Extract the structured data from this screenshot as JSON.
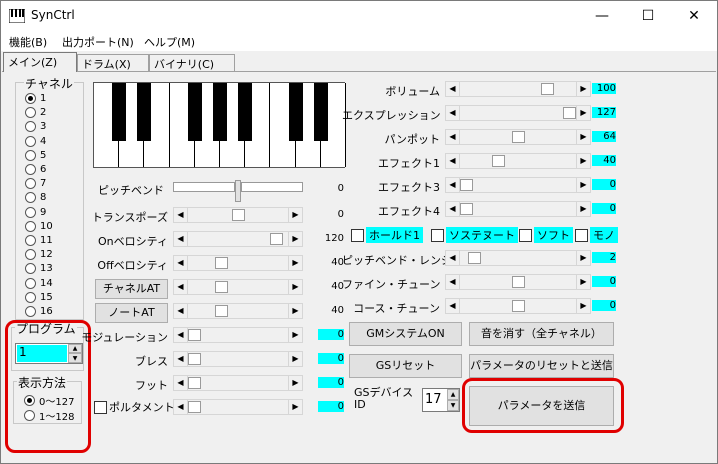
{
  "window": {
    "title": "SynCtrl",
    "minimize": "—",
    "maximize": "☐",
    "close": "✕"
  },
  "menu": [
    "機能(B)",
    "出力ポート(N)",
    "ヘルプ(M)"
  ],
  "tabs": [
    "メイン(Z)",
    "ドラム(X)",
    "バイナリ(C)"
  ],
  "channel": {
    "title": "チャネル",
    "items": [
      "1",
      "2",
      "3",
      "4",
      "5",
      "6",
      "7",
      "8",
      "9",
      "10",
      "11",
      "12",
      "13",
      "14",
      "15",
      "16"
    ],
    "selected": "1"
  },
  "program": {
    "title": "プログラム",
    "value": "1"
  },
  "display": {
    "title": "表示方法",
    "options": [
      "0〜127",
      "1〜128"
    ],
    "selected": "0〜127"
  },
  "left_controls": [
    {
      "label": "トランスポーズ",
      "value": "0",
      "fraction": 0.5,
      "cyan": false
    },
    {
      "label": "Onベロシティ",
      "value": "120",
      "fraction": 0.94,
      "cyan": false
    },
    {
      "label": "Offベロシティ",
      "value": "40",
      "fraction": 0.31,
      "cyan": false
    },
    {
      "label": "チャネルAT",
      "value": "40",
      "fraction": 0.31,
      "cyan": false,
      "button": true
    },
    {
      "label": "ノートAT",
      "value": "40",
      "fraction": 0.31,
      "cyan": false,
      "button": true
    },
    {
      "label": "モジュレーション",
      "value": "0",
      "fraction": 0,
      "cyan": true
    },
    {
      "label": "ブレス",
      "value": "0",
      "fraction": 0,
      "cyan": true
    },
    {
      "label": "フット",
      "value": "0",
      "fraction": 0,
      "cyan": true
    },
    {
      "label": "ポルタメント",
      "value": "0",
      "fraction": 0,
      "cyan": true,
      "check": true
    }
  ],
  "pitchbend": {
    "label": "ピッチベンド",
    "value": "0"
  },
  "right_controls": [
    {
      "label": "ボリューム",
      "value": "100",
      "fraction": 0.79
    },
    {
      "label": "エクスプレッション",
      "value": "127",
      "fraction": 1.0
    },
    {
      "label": "パンポット",
      "value": "64",
      "fraction": 0.5
    },
    {
      "label": "エフェクト1",
      "value": "40",
      "fraction": 0.31
    },
    {
      "label": "エフェクト3",
      "value": "0",
      "fraction": 0
    },
    {
      "label": "エフェクト4",
      "value": "0",
      "fraction": 0
    }
  ],
  "toggles": [
    "ホールド1",
    "ソステヌート",
    "ソフト",
    "モノ"
  ],
  "right_controls2": [
    {
      "label": "ピッチベンド・レンジ",
      "value": "2",
      "fraction": 0.08
    },
    {
      "label": "ファイン・チューン",
      "value": "0",
      "fraction": 0.5
    },
    {
      "label": "コース・チューン",
      "value": "0",
      "fraction": 0.5
    }
  ],
  "buttons": {
    "gm_on": "GMシステムON",
    "mute_all": "音を消す（全チャネル）",
    "gs_reset": "GSリセット",
    "reset_send": "パラメータのリセットと送信",
    "send": "パラメータを送信"
  },
  "gs_device": {
    "label": "GSデバイス ID",
    "value": "17"
  }
}
